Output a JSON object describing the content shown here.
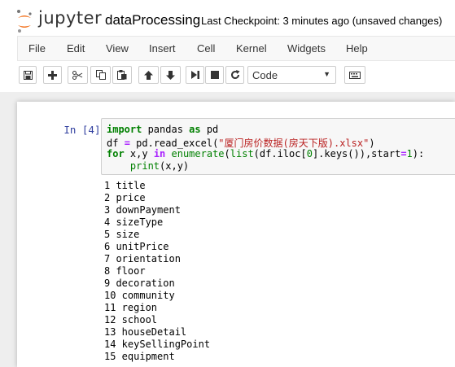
{
  "header": {
    "logo_text": "jupyter",
    "notebook_title": "dataProcessing",
    "checkpoint": "Last Checkpoint: 3 minutes ago (unsaved changes)"
  },
  "menubar": {
    "items": [
      "File",
      "Edit",
      "View",
      "Insert",
      "Cell",
      "Kernel",
      "Widgets",
      "Help"
    ]
  },
  "toolbar": {
    "buttons": [
      "save-icon",
      "plus-icon",
      "cut-icon",
      "copy-icon",
      "paste-icon",
      "arrow-up-icon",
      "arrow-down-icon",
      "step-forward-icon",
      "stop-icon",
      "refresh-icon",
      "keyboard-icon"
    ],
    "cell_type": "Code"
  },
  "cell": {
    "prompt": "In [4]:",
    "code": [
      "import pandas as pd",
      "df = pd.read_excel(\"厦门房价数据(房天下版).xlsx\")",
      "for x,y in enumerate(list(df.iloc[0].keys()),start=1):",
      "    print(x,y)"
    ],
    "output": [
      "1 title",
      "2 price",
      "3 downPayment",
      "4 sizeType",
      "5 size",
      "6 unitPrice",
      "7 orientation",
      "8 floor",
      "9 decoration",
      "10 community",
      "11 region",
      "12 school",
      "13 houseDetail",
      "14 keySellingPoint",
      "15 equipment"
    ]
  },
  "colors": {
    "keyword": "#008000",
    "string": "#ba2121",
    "operator": "#aa22ff",
    "prompt": "#303f9f",
    "logo_orange": "#f37726"
  }
}
